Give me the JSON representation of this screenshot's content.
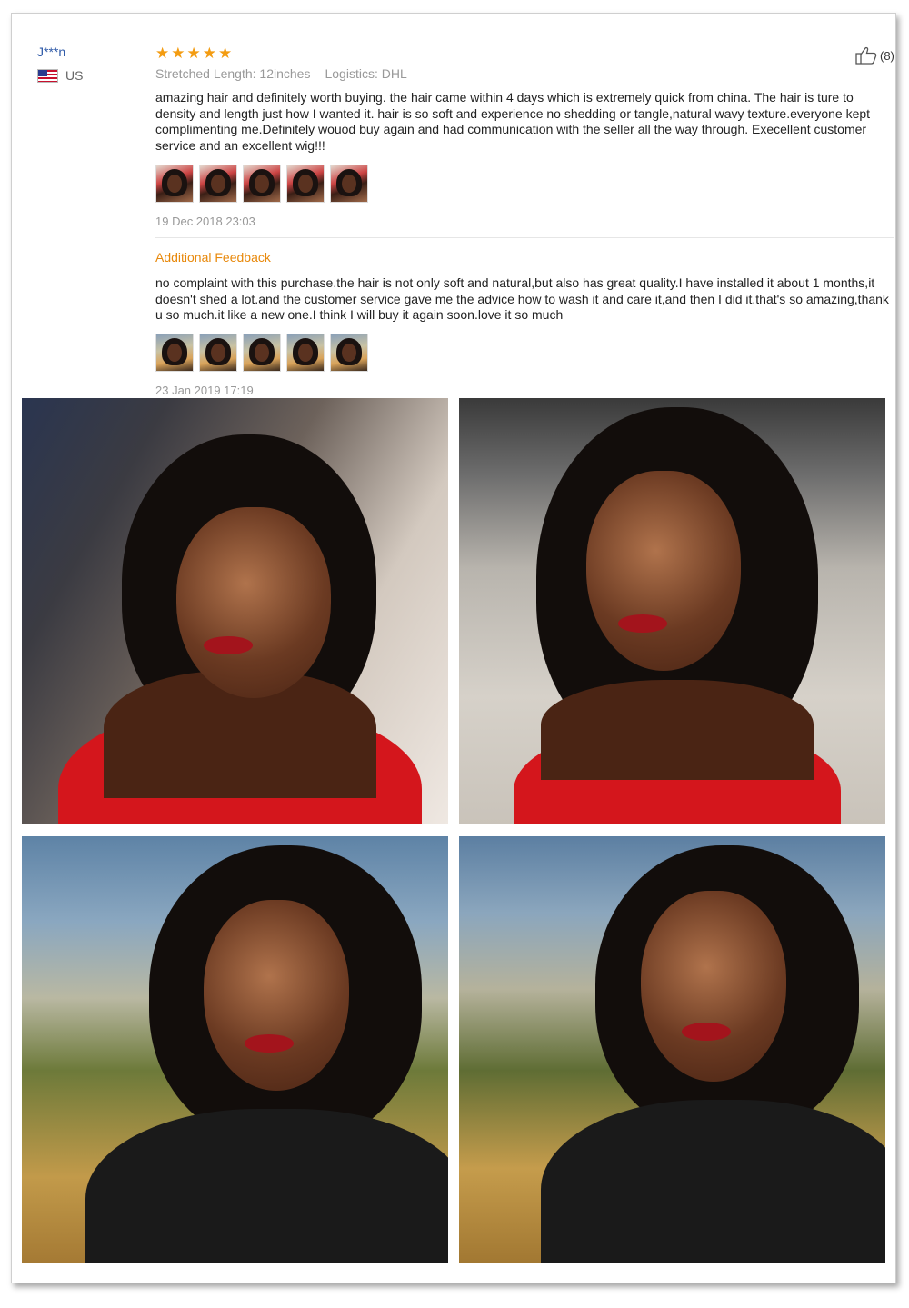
{
  "user": {
    "name": "J***n",
    "country": "US"
  },
  "review": {
    "rating": 5,
    "stars": [
      "★",
      "★",
      "★",
      "★",
      "★"
    ],
    "stretched_length": "Stretched Length: 12inches",
    "logistics": "Logistics: DHL",
    "text": "amazing hair and definitely worth buying. the hair came within 4 days which is extremely quick from china. The hair is ture to density and length just how I wanted it. hair is so soft and experience no shedding or tangle,natural wavy texture.everyone kept complimenting me.Definitely wouod buy again and had communication with the seller all the way through. Execellent customer service and an excellent wig!!!",
    "date": "19 Dec 2018 23:03",
    "likes": "(8)"
  },
  "additional": {
    "title": "Additional Feedback",
    "text": "no complaint with this purchase.the hair is not only soft and natural,but also has great quality.I have installed it about 1 months,it doesn't shed a lot.and the customer service gave me the advice how to wash it and care it,and then I did it.that's so amazing,thank u so much.it like a new one.I think I will buy it again soon.love it so much",
    "date": "23 Jan 2019 17:19"
  },
  "icons": {
    "like": "thumbs-up-icon",
    "flag": "us-flag-icon",
    "star": "star-icon"
  },
  "colors": {
    "username": "#2f5aa8",
    "star": "#f39c12",
    "additional": "#e8890c",
    "meta": "#999999"
  }
}
